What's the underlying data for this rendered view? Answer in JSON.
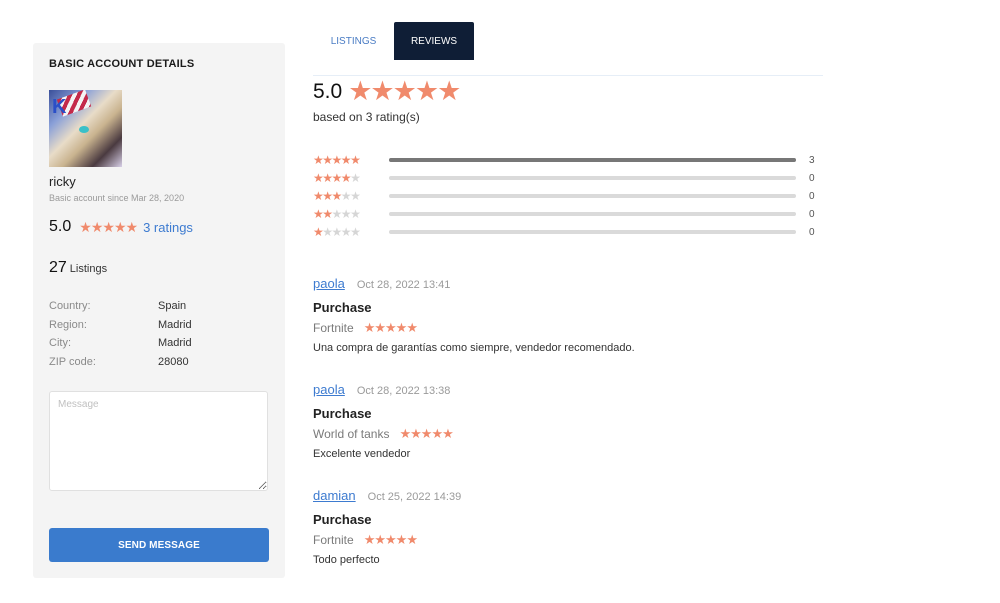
{
  "sidebar": {
    "title": "BASIC ACCOUNT DETAILS",
    "avatar_alt": "user avatar",
    "username": "ricky",
    "since": "Basic account since Mar 28, 2020",
    "rating": "5.0",
    "rating_stars": 5,
    "ratings_link": "3 ratings",
    "listings_count": "27",
    "listings_label": "Listings",
    "info": [
      {
        "label": "Country:",
        "value": "Spain"
      },
      {
        "label": "Region:",
        "value": "Madrid"
      },
      {
        "label": "City:",
        "value": "Madrid"
      },
      {
        "label": "ZIP code:",
        "value": "28080"
      }
    ],
    "message_placeholder": "Message",
    "send_label": "SEND MESSAGE"
  },
  "tabs": [
    {
      "label": "LISTINGS",
      "active": false
    },
    {
      "label": "REVIEWS",
      "active": true
    }
  ],
  "summary": {
    "score": "5.0",
    "stars": 5,
    "based_on": "based on 3 rating(s)"
  },
  "distribution": [
    {
      "stars": 5,
      "count": "3",
      "fraction": 1.0
    },
    {
      "stars": 4,
      "count": "0",
      "fraction": 0
    },
    {
      "stars": 3,
      "count": "0",
      "fraction": 0
    },
    {
      "stars": 2,
      "count": "0",
      "fraction": 0
    },
    {
      "stars": 1,
      "count": "0",
      "fraction": 0
    }
  ],
  "reviews": [
    {
      "user": "paola",
      "date": "Oct 28, 2022 13:41",
      "type": "Purchase",
      "game": "Fortnite",
      "stars": 5,
      "text": "Una compra de garantías como siempre, vendedor recomendado."
    },
    {
      "user": "paola",
      "date": "Oct 28, 2022 13:38",
      "type": "Purchase",
      "game": "World of tanks",
      "stars": 5,
      "text": "Excelente vendedor"
    },
    {
      "user": "damian",
      "date": "Oct 25, 2022 14:39",
      "type": "Purchase",
      "game": "Fortnite",
      "stars": 5,
      "text": "Todo perfecto"
    }
  ],
  "colors": {
    "star": "#f08a6c",
    "star_off": "#d6d6d6",
    "link": "#3d7bd0",
    "button": "#3a7bcd",
    "active_tab": "#0f1e36"
  }
}
